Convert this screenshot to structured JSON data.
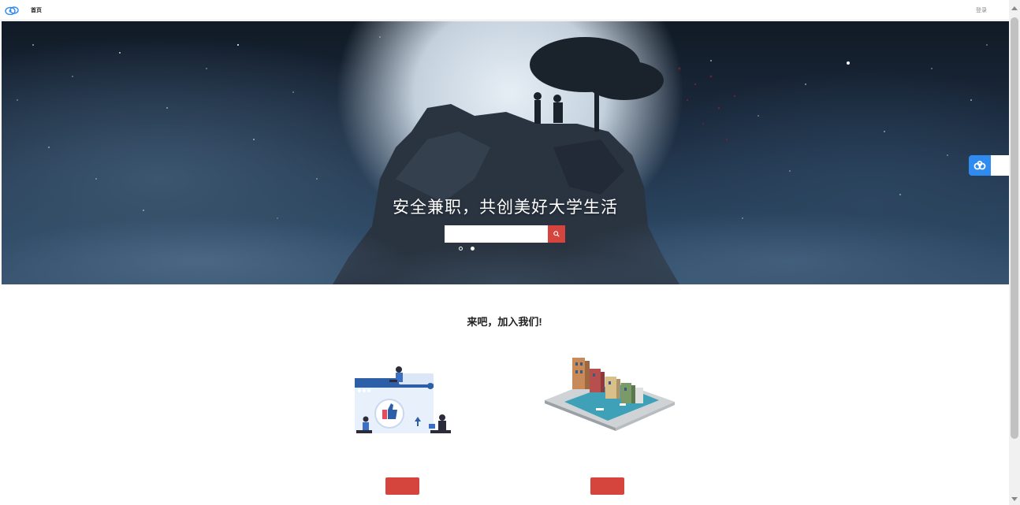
{
  "nav": {
    "logo_text": "",
    "items": [
      {
        "label": "首页",
        "active": true
      },
      {
        "label": "",
        "active": false
      },
      {
        "label": "",
        "active": false
      },
      {
        "label": "",
        "active": false
      }
    ],
    "right": {
      "login": "登录",
      "register": ""
    }
  },
  "hero": {
    "title": "安全兼职，共创美好大学生活",
    "search": {
      "placeholder": "",
      "button_icon": "search-icon"
    },
    "options": [
      {
        "label": "",
        "selected": false
      },
      {
        "label": "",
        "selected": true
      }
    ]
  },
  "side_badge": {
    "icon": "cloud-icon",
    "label": ""
  },
  "intro": {
    "line1": "",
    "line2": "",
    "title": "来吧，加入我们!"
  },
  "cards": [
    {
      "button": "",
      "description": "",
      "illustration": "teamwork-like-illustration"
    },
    {
      "button": "",
      "description": "",
      "illustration": "isometric-city-illustration"
    }
  ],
  "colors": {
    "accent_red": "#d6453d",
    "badge_blue": "#2f8bf0"
  }
}
